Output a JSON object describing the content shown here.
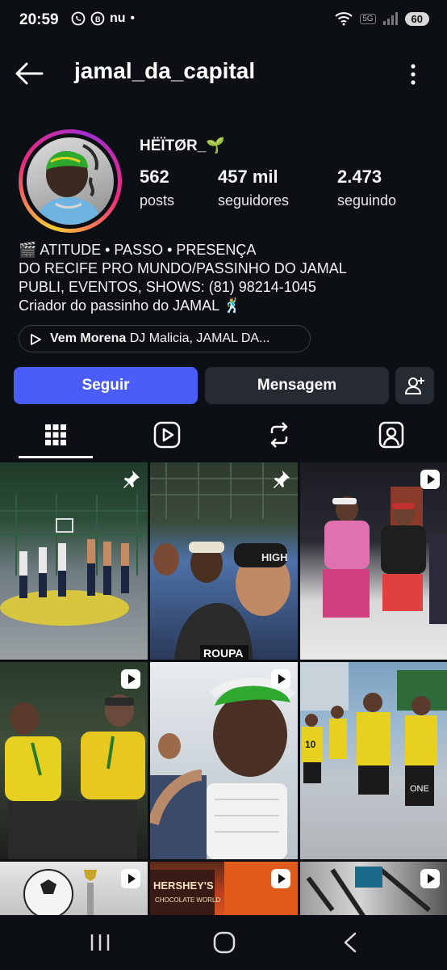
{
  "status_bar": {
    "time": "20:59",
    "left_icons": [
      "whatsapp-icon",
      "whatsapp-business-icon",
      "nu-icon",
      "dot-icon"
    ],
    "nu_text": "nu",
    "network_label": "5G",
    "battery": "60"
  },
  "header": {
    "username": "jamal_da_capital"
  },
  "profile": {
    "display_name": "HËÏTØR_🌱",
    "posts_count": "562",
    "posts_label": "posts",
    "followers_count": "457 mil",
    "followers_label": "seguidores",
    "following_count": "2.473",
    "following_label": "seguindo",
    "bio": [
      "🎬 ATITUDE • PASSO • PRESENÇA",
      "DO RECIFE PRO MUNDO/PASSINHO DO JAMAL",
      "PUBLI, EVENTOS, SHOWS: (81) 98214-1045",
      "Criador do passinho do JAMAL 🕺"
    ],
    "music_title": "Vem Morena",
    "music_artist": "DJ Malicia, JAMAL DA..."
  },
  "actions": {
    "follow": "Seguir",
    "message": "Mensagem"
  },
  "colors": {
    "background": "#0c0f14",
    "follow_button": "#4a5df9",
    "secondary_button": "#262a31"
  },
  "tabs": [
    "grid-icon",
    "reels-icon",
    "reposts-icon",
    "tagged-icon"
  ],
  "grid_overlay_text": {
    "cap_text": "HIGH",
    "post2_caption": "ROUPA",
    "jersey_number": "10",
    "shirt_text": "ONE",
    "candy_brand": "HERSHEY'S",
    "candy_subtitle": "CHOCOLATE WORLD"
  }
}
